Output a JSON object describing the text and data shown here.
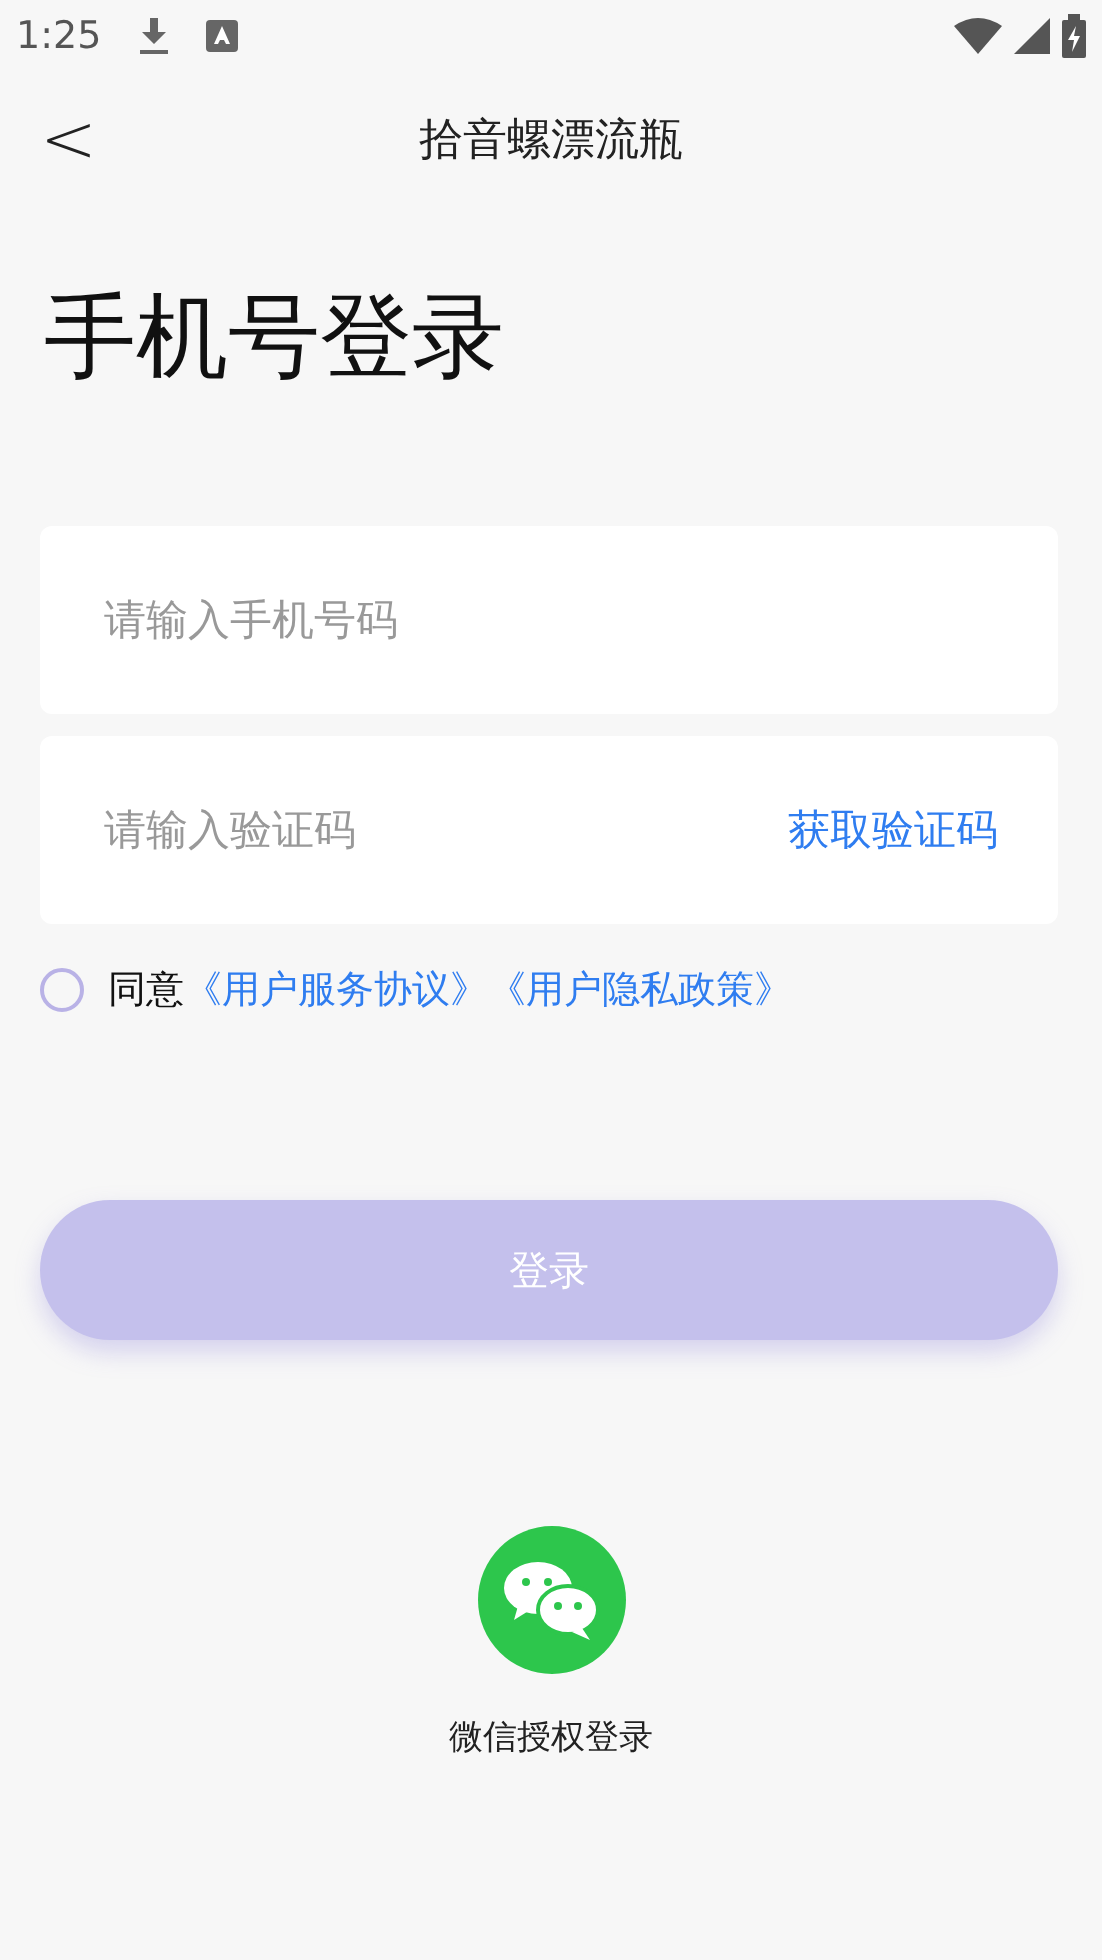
{
  "status_bar": {
    "time": "1:25"
  },
  "header": {
    "back": "<",
    "title": "拾音螺漂流瓶"
  },
  "heading": "手机号登录",
  "phone_field": {
    "placeholder": "请输入手机号码"
  },
  "code_field": {
    "placeholder": "请输入验证码",
    "action": "获取验证码"
  },
  "agreement": {
    "checked": false,
    "text": "同意",
    "links": [
      "《用户服务协议》",
      "《用户隐私政策》"
    ]
  },
  "login_button": {
    "label": "登录",
    "disabled": true
  },
  "wechat_login": {
    "label": "微信授权登录"
  }
}
